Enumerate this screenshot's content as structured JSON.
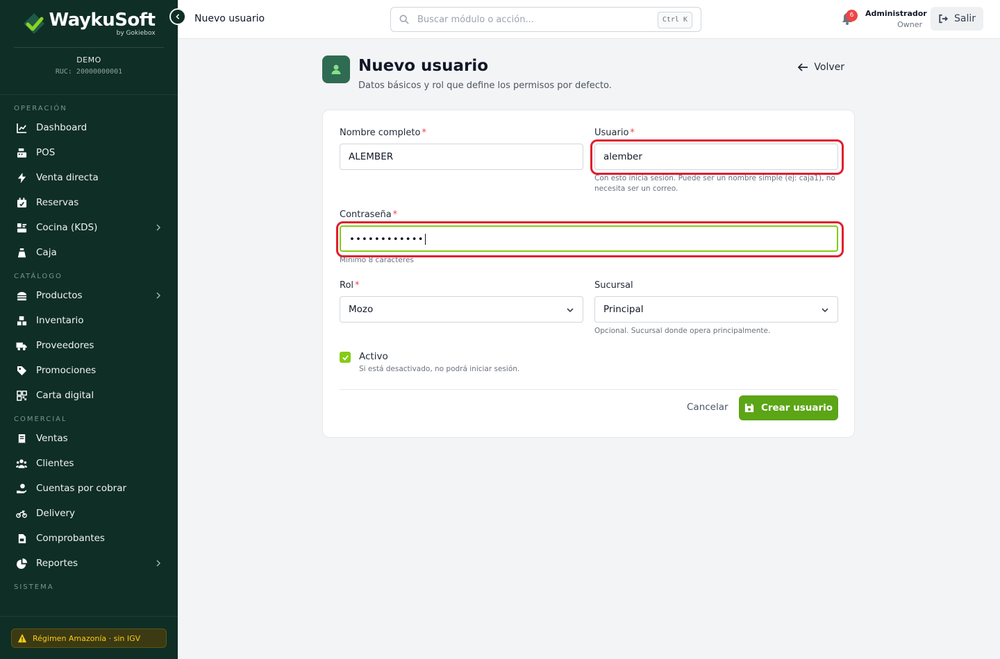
{
  "brand": {
    "name": "WaykuSoft",
    "sub": "by Gokiebox"
  },
  "company": {
    "name": "DEMO",
    "ruc": "RUC: 20000000001"
  },
  "sidebar": {
    "sections": [
      {
        "title": "OPERACIÓN",
        "items": [
          {
            "label": "Dashboard",
            "icon": "chart-line-icon"
          },
          {
            "label": "POS",
            "icon": "cash-register-icon"
          },
          {
            "label": "Venta directa",
            "icon": "bolt-icon"
          },
          {
            "label": "Reservas",
            "icon": "calendar-check-icon"
          },
          {
            "label": "Cocina (KDS)",
            "icon": "kitchen-icon",
            "expandable": true
          },
          {
            "label": "Caja",
            "icon": "money-bag-icon"
          }
        ]
      },
      {
        "title": "CATÁLOGO",
        "items": [
          {
            "label": "Productos",
            "icon": "burger-icon",
            "expandable": true
          },
          {
            "label": "Inventario",
            "icon": "boxes-icon"
          },
          {
            "label": "Proveedores",
            "icon": "truck-icon"
          },
          {
            "label": "Promociones",
            "icon": "tags-icon"
          },
          {
            "label": "Carta digital",
            "icon": "qrcode-icon"
          }
        ]
      },
      {
        "title": "COMERCIAL",
        "items": [
          {
            "label": "Ventas",
            "icon": "receipt-icon"
          },
          {
            "label": "Clientes",
            "icon": "users-icon"
          },
          {
            "label": "Cuentas por cobrar",
            "icon": "hand-coin-icon"
          },
          {
            "label": "Delivery",
            "icon": "motorcycle-icon"
          },
          {
            "label": "Comprobantes",
            "icon": "file-invoice-icon"
          },
          {
            "label": "Reportes",
            "icon": "pie-chart-icon",
            "expandable": true
          }
        ]
      },
      {
        "title": "SISTEMA",
        "items": []
      }
    ],
    "footer_label": "Régimen Amazonía · sin IGV"
  },
  "topbar": {
    "title": "Nuevo usuario",
    "search_placeholder": "Buscar módulo o acción...",
    "search_shortcut": "Ctrl K",
    "notifications_count": "6",
    "user_name": "Administrador",
    "user_role": "Owner",
    "logout_label": "Salir"
  },
  "page": {
    "title": "Nuevo usuario",
    "subtitle": "Datos básicos y rol que define los permisos por defecto.",
    "back_label": "Volver"
  },
  "form": {
    "full_name": {
      "label": "Nombre completo",
      "value": "ALEMBER"
    },
    "username": {
      "label": "Usuario",
      "value": "alember",
      "help": "Con esto inicia sesión. Puede ser un nombre simple (ej: caja1), no necesita ser un correo."
    },
    "password": {
      "label": "Contraseña",
      "value": "••••••••••••",
      "help": "Mínimo 8 caracteres"
    },
    "role": {
      "label": "Rol",
      "value": "Mozo"
    },
    "branch": {
      "label": "Sucursal",
      "value": "Principal",
      "help": "Opcional. Sucursal donde opera principalmente."
    },
    "active": {
      "label": "Activo",
      "help": "Si está desactivado, no podrá iniciar sesión.",
      "checked": true
    },
    "required_mark": "*",
    "cancel_label": "Cancelar",
    "submit_label": "Crear usuario"
  },
  "colors": {
    "sidebar_bg": "#0f2e25",
    "accent_green": "#5ba516",
    "highlight_red": "#e11d2e"
  }
}
